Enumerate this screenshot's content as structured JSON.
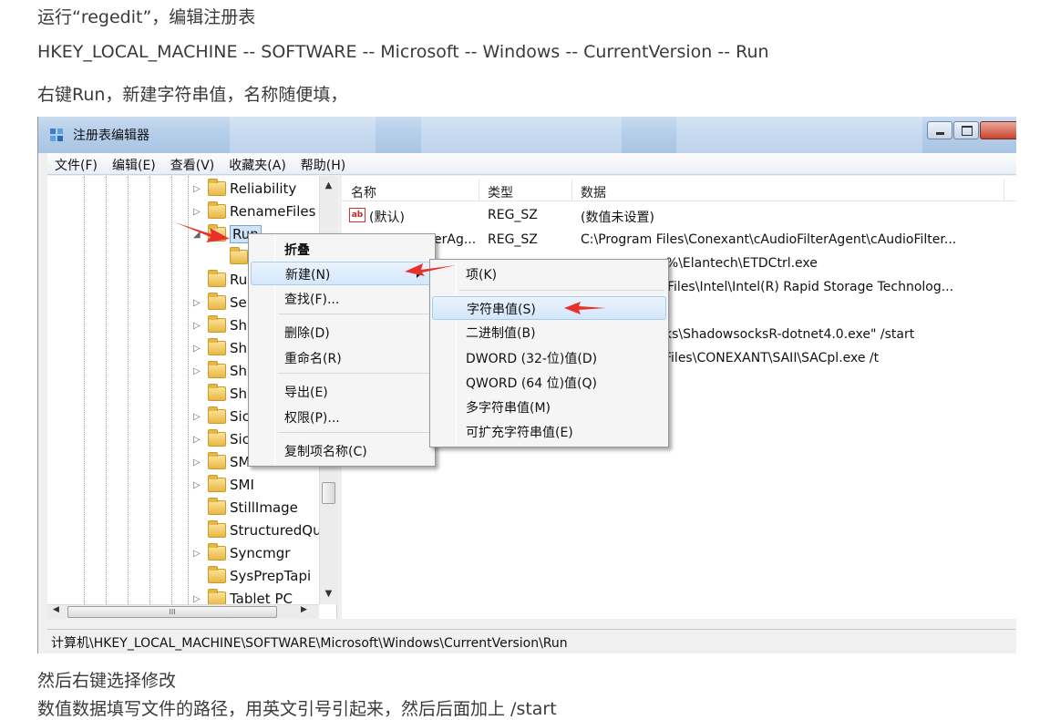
{
  "article": {
    "line1": "运行“regedit”，编辑注册表",
    "line2": "HKEY_LOCAL_MACHINE -- SOFTWARE -- Microsoft -- Windows -- CurrentVersion -- Run",
    "line3": "右键Run，新建字符串值，名称随便填，",
    "line4": "然后右键选择修改",
    "line5": "数值数据填写文件的路径，用英文引号引起来，然后后面加上 /start"
  },
  "window": {
    "title": "注册表编辑器",
    "menu": [
      "文件(F)",
      "编辑(E)",
      "查看(V)",
      "收藏夹(A)",
      "帮助(H)"
    ]
  },
  "tree": {
    "items": [
      {
        "label": "Reliability",
        "expander": "▷"
      },
      {
        "label": "RenameFiles",
        "expander": "▷"
      },
      {
        "label": "Run",
        "expander": "◢"
      },
      {
        "label": "",
        "expander": ""
      },
      {
        "label": "Ru",
        "expander": ""
      },
      {
        "label": "Se",
        "expander": "▷"
      },
      {
        "label": "Sh",
        "expander": "▷"
      },
      {
        "label": "Sh",
        "expander": "▷"
      },
      {
        "label": "Sh",
        "expander": "▷"
      },
      {
        "label": "Sh",
        "expander": ""
      },
      {
        "label": "Sic",
        "expander": "▷"
      },
      {
        "label": "Sic",
        "expander": "▷"
      },
      {
        "label": "SM",
        "expander": "▷"
      },
      {
        "label": "SMI",
        "expander": "▷"
      },
      {
        "label": "StillImage",
        "expander": ""
      },
      {
        "label": "StructuredQu",
        "expander": ""
      },
      {
        "label": "Syncmgr",
        "expander": "▷"
      },
      {
        "label": "SysPrepTapi",
        "expander": ""
      },
      {
        "label": "Tablet PC",
        "expander": "▷"
      }
    ],
    "hscroll_thumb": "III"
  },
  "list": {
    "columns": [
      "名称",
      "类型",
      "数据"
    ],
    "rows": [
      {
        "name": "(默认)",
        "type": "REG_SZ",
        "data": "(数值未设置)"
      },
      {
        "name": "erAg...",
        "type": "REG_SZ",
        "data": "C:\\Program Files\\Conexant\\cAudioFilterAgent\\cAudioFilter..."
      },
      {
        "name": "",
        "type": "",
        "data": "es%\\Elantech\\ETDCtrl.exe"
      },
      {
        "name": "",
        "type": "",
        "data": "Files\\Intel\\Intel(R) Rapid Storage Technolog..."
      },
      {
        "name": "",
        "type": "",
        "data": ""
      },
      {
        "name": "",
        "type": "",
        "data": "ks\\ShadowsocksR-dotnet4.0.exe\" /start"
      },
      {
        "name": "",
        "type": "",
        "data": "Files\\CONEXANT\\SAII\\SACpl.exe /t"
      }
    ],
    "default_icon": "ab"
  },
  "status_path": "计算机\\HKEY_LOCAL_MACHINE\\SOFTWARE\\Microsoft\\Windows\\CurrentVersion\\Run",
  "context_menu": {
    "items": [
      "折叠",
      "新建(N)",
      "查找(F)...",
      "删除(D)",
      "重命名(R)",
      "导出(E)",
      "权限(P)...",
      "复制项名称(C)"
    ]
  },
  "sub_menu": {
    "items": [
      "项(K)",
      "字符串值(S)",
      "二进制值(B)",
      "DWORD (32-位)值(D)",
      "QWORD (64 位)值(Q)",
      "多字符串值(M)",
      "可扩充字符串值(E)"
    ]
  },
  "colors": {
    "arrow": "#e8312a",
    "highlight": "#d3e7fb",
    "titlebar": "#b8d0ea"
  }
}
